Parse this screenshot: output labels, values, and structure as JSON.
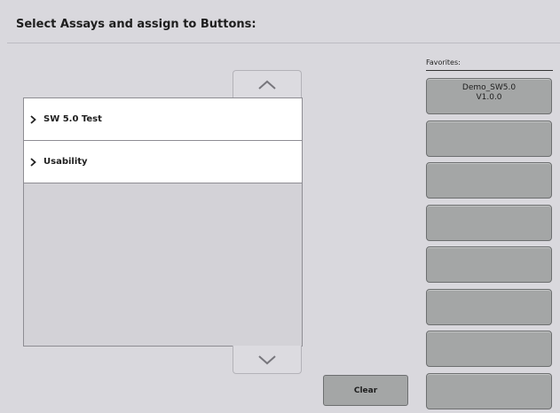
{
  "header": {
    "title": "Select Assays and assign to Buttons:"
  },
  "assay_list": {
    "items": [
      {
        "label": "SW 5.0 Test"
      },
      {
        "label": "Usability"
      }
    ],
    "scroll_up_icon": "chevron-up-icon",
    "scroll_down_icon": "chevron-down-icon"
  },
  "favorites": {
    "label": "Favorites:",
    "buttons": [
      {
        "line1": "Demo_SW5.0",
        "line2": "V1.0.0"
      },
      {
        "line1": "",
        "line2": ""
      },
      {
        "line1": "",
        "line2": ""
      },
      {
        "line1": "",
        "line2": ""
      },
      {
        "line1": "",
        "line2": ""
      },
      {
        "line1": "",
        "line2": ""
      },
      {
        "line1": "",
        "line2": ""
      },
      {
        "line1": "",
        "line2": ""
      }
    ]
  },
  "actions": {
    "clear_label": "Clear"
  },
  "colors": {
    "background": "#d9d8dd",
    "button_gray": "#a4a6a6",
    "list_item_bg": "#ffffff"
  }
}
